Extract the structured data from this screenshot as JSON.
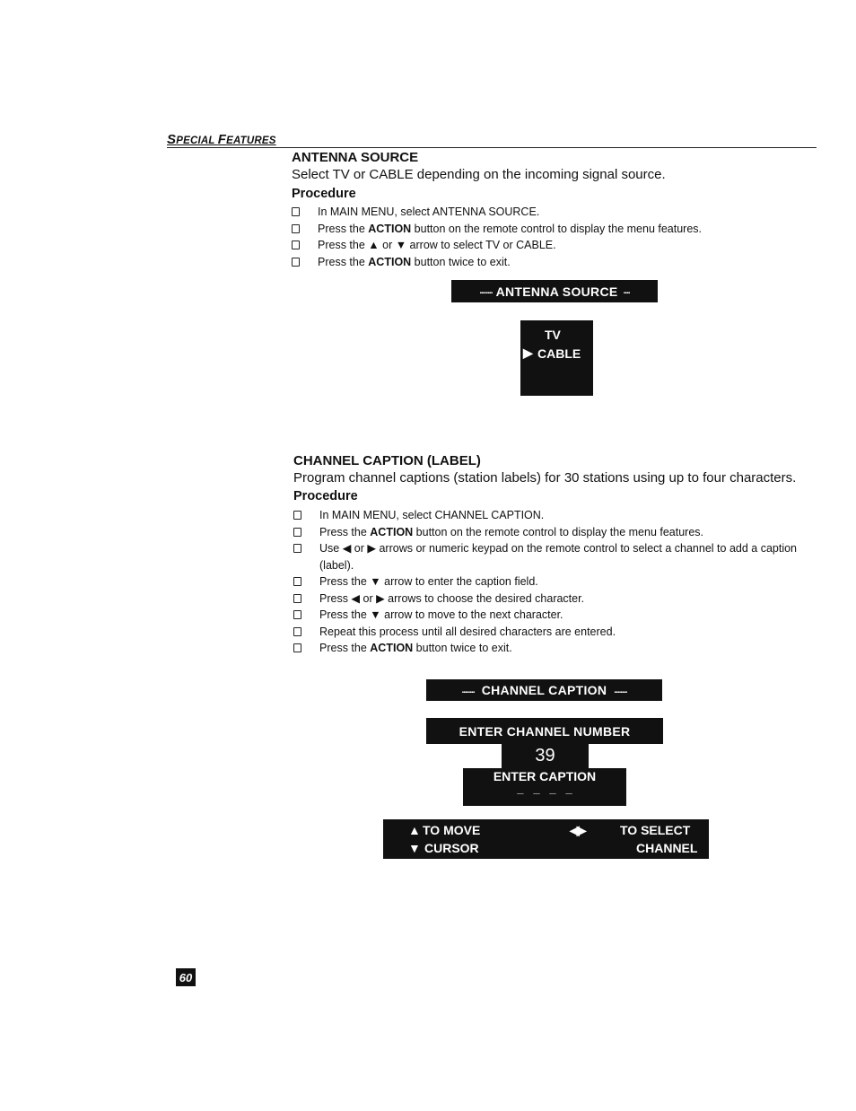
{
  "header": {
    "section_title_parts": [
      "S",
      "PECIAL ",
      "F",
      "EATURES"
    ]
  },
  "antenna": {
    "title": "ANTENNA SOURCE",
    "description": "Select TV or CABLE depending on the incoming signal source.",
    "procedure_label": "Procedure",
    "steps": [
      {
        "pre": "In MAIN MENU, select ANTENNA SOURCE.",
        "bold": "",
        "post": ""
      },
      {
        "pre": "Press the ",
        "bold": "ACTION",
        "post": " button on the remote control to display the menu features."
      },
      {
        "pre": "Press the ▲ or ▼ arrow to select TV or CABLE.",
        "bold": "",
        "post": ""
      },
      {
        "pre": "Press the ",
        "bold": "ACTION",
        "post": " button twice to exit."
      }
    ],
    "osd": {
      "title_dots": "........",
      "title": "ANTENNA SOURCE",
      "options": [
        "TV",
        "CABLE"
      ],
      "selected_marker": "▶",
      "selected_index": 1
    }
  },
  "caption": {
    "title": "CHANNEL CAPTION (LABEL)",
    "description": "Program channel captions (station labels) for 30 stations using up to four characters.",
    "procedure_label": "Procedure",
    "steps": [
      {
        "pre": "In MAIN MENU, select CHANNEL CAPTION.",
        "bold": "",
        "post": ""
      },
      {
        "pre": "Press the ",
        "bold": "ACTION",
        "post": " button on the remote control to display the menu features."
      },
      {
        "pre": "Use ◀ or ▶  arrows or numeric keypad on the remote control to select a channel to add a caption (label).",
        "bold": "",
        "post": ""
      },
      {
        "pre": "Press the  ▼ arrow to enter the caption field.",
        "bold": "",
        "post": ""
      },
      {
        "pre": "Press  ◀ or ▶ arrows to choose the desired character.",
        "bold": "",
        "post": ""
      },
      {
        "pre": "Press the ▼ arrow to move to the next character.",
        "bold": "",
        "post": ""
      },
      {
        "pre": "Repeat this process until all desired characters are entered.",
        "bold": "",
        "post": ""
      },
      {
        "pre": "Press the ",
        "bold": "ACTION",
        "post": " button twice to exit."
      }
    ],
    "osd": {
      "title_dots_left": "........",
      "title": "CHANNEL CAPTION",
      "title_dots_right": "........",
      "enter_channel_label": "ENTER CHANNEL NUMBER",
      "channel_number": "39",
      "enter_caption_label": "ENTER CAPTION",
      "caption_slots": "_   _   _   _",
      "footer": {
        "up_arrow": "▲",
        "down_arrow": "▼",
        "move_line1": "TO MOVE",
        "move_line2": "CURSOR",
        "lr_arrows": "◀▶",
        "select_line1": "TO SELECT",
        "select_line2": "CHANNEL"
      }
    }
  },
  "footer": {
    "page_number": "60"
  }
}
